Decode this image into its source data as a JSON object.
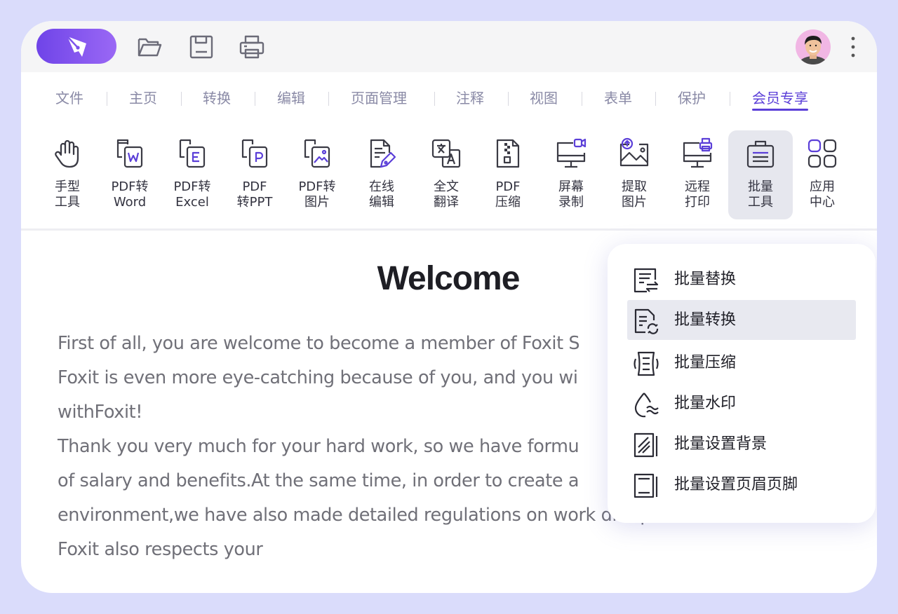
{
  "titlebar": {
    "logo_icon": "foxit-pen-logo-icon",
    "actions": [
      "open-folder-icon",
      "save-icon",
      "print-icon"
    ],
    "avatar": "user-avatar",
    "more_icon": "more-vertical-icon"
  },
  "tabs": [
    {
      "label": "文件"
    },
    {
      "label": "主页"
    },
    {
      "label": "转换"
    },
    {
      "label": "编辑"
    },
    {
      "label": "页面管理"
    },
    {
      "label": "注释"
    },
    {
      "label": "视图"
    },
    {
      "label": "表单"
    },
    {
      "label": "保护"
    },
    {
      "label": "会员专享",
      "active": true
    }
  ],
  "ribbon": [
    {
      "label": "手型\n工具",
      "icon": "hand-tool-icon"
    },
    {
      "label": "PDF转\nWord",
      "icon": "pdf-to-word-icon"
    },
    {
      "label": "PDF转\nExcel",
      "icon": "pdf-to-excel-icon"
    },
    {
      "label": "PDF\n转PPT",
      "icon": "pdf-to-ppt-icon"
    },
    {
      "label": "PDF转\n图片",
      "icon": "pdf-to-image-icon"
    },
    {
      "label": "在线\n编辑",
      "icon": "online-edit-icon"
    },
    {
      "label": "全文\n翻译",
      "icon": "translate-icon"
    },
    {
      "label": "PDF\n压缩",
      "icon": "pdf-compress-icon"
    },
    {
      "label": "屏幕\n录制",
      "icon": "screen-record-icon"
    },
    {
      "label": "提取\n图片",
      "icon": "extract-image-icon"
    },
    {
      "label": "远程\n打印",
      "icon": "remote-print-icon"
    },
    {
      "label": "批量\n工具",
      "icon": "batch-tools-icon",
      "active": true
    },
    {
      "label": "应用\n中心",
      "icon": "app-center-icon"
    }
  ],
  "document": {
    "title": "Welcome",
    "lines": [
      "First of all, you are welcome to become a member of Foxit S",
      "Foxit is even more eye-catching because of you, and you wi",
      "withFoxit!",
      "Thank you very much for your hard work, so we have formu",
      "of salary and benefits.At the same time, in order to create a",
      "environment,we have also made detailed regulations on work discipline.Of course,",
      "Foxit also respects your"
    ]
  },
  "dropdown": {
    "items": [
      {
        "label": "批量替换",
        "icon": "batch-replace-icon"
      },
      {
        "label": "批量转换",
        "icon": "batch-convert-icon",
        "active": true
      },
      {
        "label": "批量压缩",
        "icon": "batch-compress-icon"
      },
      {
        "label": "批量水印",
        "icon": "batch-watermark-icon"
      },
      {
        "label": "批量设置背景",
        "icon": "batch-background-icon"
      },
      {
        "label": "批量设置页眉页脚",
        "icon": "batch-header-footer-icon"
      }
    ]
  },
  "colors": {
    "accent": "#5b3fd8",
    "background": "#dadcfb",
    "tab_inactive": "#8a8aa6"
  }
}
